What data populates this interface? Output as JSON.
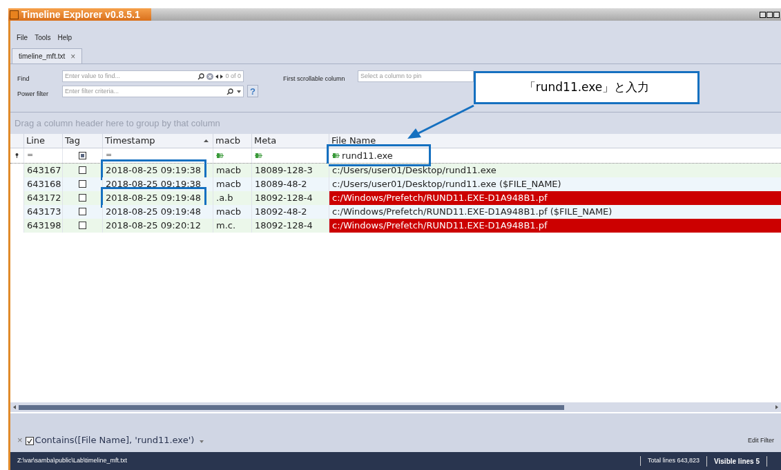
{
  "window": {
    "title": "Timeline Explorer v0.8.5.1"
  },
  "menu": [
    "File",
    "Tools",
    "Help"
  ],
  "tabs": [
    {
      "label": "timeline_mft.txt",
      "selected": true,
      "close": "×"
    }
  ],
  "find": {
    "label": "Find",
    "placeholder": "Enter value to find...",
    "count": "0 of 0"
  },
  "first_scrollable_column": {
    "label": "First scrollable column",
    "placeholder": "Select a column to pin"
  },
  "power_filter": {
    "label": "Power filter",
    "placeholder": "Enter filter criteria...",
    "help": "?"
  },
  "group_panel": "Drag a column header here to group by that column",
  "table": {
    "columns": [
      {
        "label": "Line",
        "sorted": false
      },
      {
        "label": "Tag",
        "sorted": false
      },
      {
        "label": "Timestamp",
        "sorted": true
      },
      {
        "label": "macb",
        "sorted": false
      },
      {
        "label": "Meta",
        "sorted": false
      },
      {
        "label": "File Name",
        "sorted": false
      }
    ],
    "filter_row": [
      {
        "kind": "operator",
        "text": "="
      },
      {
        "kind": "tristate",
        "indeterminate": true
      },
      {
        "kind": "operator",
        "text": "="
      },
      {
        "kind": "text"
      },
      {
        "kind": "text"
      },
      {
        "kind": "text",
        "value": "rund11.exe",
        "boxed": true
      }
    ],
    "rows": [
      {
        "line": "643167",
        "tagged": false,
        "timestamp": "2018-08-25 09:19:38",
        "timestamp_boxed": true,
        "macb": "macb",
        "meta": "18089-128-3",
        "file_name": "c:/Users/user01/Desktop/rund11.exe",
        "highlighted": false
      },
      {
        "line": "643168",
        "tagged": false,
        "timestamp": "2018-08-25 09:19:38",
        "timestamp_boxed": false,
        "macb": "macb",
        "meta": "18089-48-2",
        "file_name": "c:/Users/user01/Desktop/rund11.exe ($FILE_NAME)",
        "highlighted": false
      },
      {
        "line": "643172",
        "tagged": false,
        "timestamp": "2018-08-25 09:19:48",
        "timestamp_boxed": true,
        "macb": ".a.b",
        "meta": "18092-128-4",
        "file_name": "c:/Windows/Prefetch/RUND11.EXE-D1A948B1.pf",
        "highlighted": true
      },
      {
        "line": "643173",
        "tagged": false,
        "timestamp": "2018-08-25 09:19:48",
        "timestamp_boxed": false,
        "macb": "macb",
        "meta": "18092-48-2",
        "file_name": "c:/Windows/Prefetch/RUND11.EXE-D1A948B1.pf ($FILE_NAME)",
        "highlighted": false
      },
      {
        "line": "643198",
        "tagged": false,
        "timestamp": "2018-08-25 09:20:12",
        "timestamp_boxed": false,
        "macb": "m.c.",
        "meta": "18092-128-4",
        "file_name": "c:/Windows/Prefetch/RUND11.EXE-D1A948B1.pf",
        "highlighted": true
      }
    ]
  },
  "filter_bar": {
    "close": "×",
    "enabled": true,
    "expression": "Contains([File Name], 'rund11.exe')",
    "edit": "Edit Filter"
  },
  "status_bar": {
    "path": "Z:\\var\\samba\\public\\Lab\\timeline_mft.txt",
    "total_lines": "Total lines 643,823",
    "visible_lines": "Visible lines 5"
  },
  "callout": {
    "text": "「rund11.exe」と入力"
  }
}
